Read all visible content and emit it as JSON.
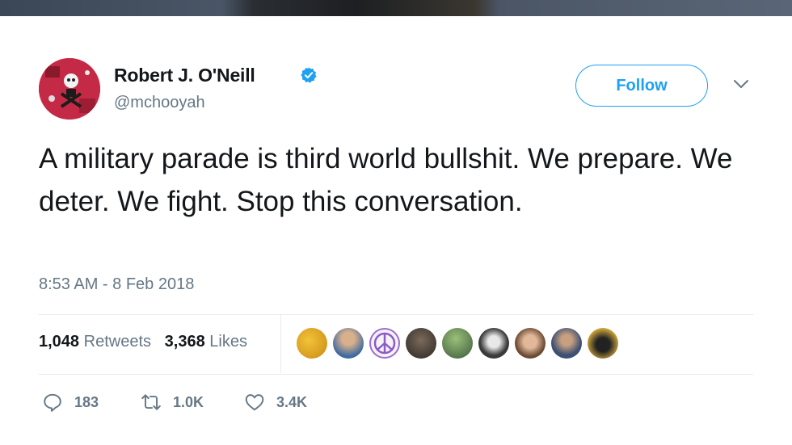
{
  "tweet": {
    "author": {
      "display_name": "Robert J. O'Neill",
      "handle": "@mchooyah",
      "verified": true
    },
    "follow_label": "Follow",
    "text": "A military parade is third world bullshit. We prepare. We deter. We fight. Stop this conversation.",
    "timestamp": "8:53 AM - 8 Feb 2018",
    "stats": {
      "retweets_count": "1,048",
      "retweets_label": "Retweets",
      "likes_count": "3,368",
      "likes_label": "Likes"
    },
    "liker_avatars": 9,
    "actions": {
      "reply_count": "183",
      "retweet_count": "1.0K",
      "like_count": "3.4K"
    }
  },
  "colors": {
    "accent": "#1da1f2",
    "text": "#14171a",
    "muted": "#657786",
    "divider": "#e6ecf0"
  },
  "icons": [
    "verified-badge-icon",
    "chevron-down-icon",
    "reply-icon",
    "retweet-icon",
    "heart-icon"
  ]
}
